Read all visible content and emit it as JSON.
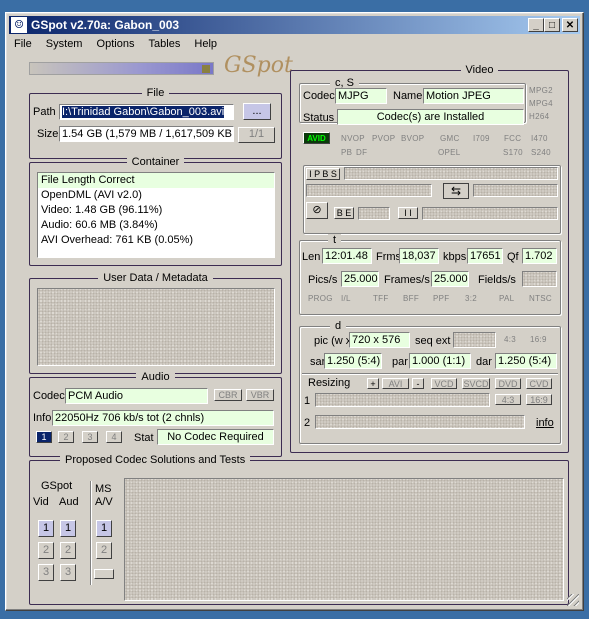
{
  "window": {
    "title": "GSpot v2.70a: Gabon_003",
    "logo": "GSpot"
  },
  "colors": {
    "title_start": "#0a246a",
    "title_end": "#a6caf0",
    "status_green": "#e8ffe0",
    "avid_green": "#00ff00"
  },
  "menu": [
    "File",
    "System",
    "Options",
    "Tables",
    "Help"
  ],
  "file": {
    "title": "File",
    "path_label": "Path",
    "path_value": "I:\\Trinidad Gabon\\Gabon_003.avi",
    "browse_label": "...",
    "size_label": "Size",
    "size_value": "1.54 GB (1,579 MB / 1,617,509 KB",
    "page_indicator": "1/1"
  },
  "container": {
    "title": "Container",
    "lines": [
      "File Length Correct",
      "OpenDML (AVI v2.0)",
      "Video: 1.48 GB (96.11%)",
      "Audio: 60.6 MB (3.84%)",
      "AVI Overhead: 761 KB (0.05%)"
    ]
  },
  "userdata": {
    "title": "User Data / Metadata"
  },
  "audio": {
    "title": "Audio",
    "codec_label": "Codec",
    "codec_value": "PCM Audio",
    "cbr": "CBR",
    "vbr": "VBR",
    "info_label": "Info",
    "info_value": "22050Hz  706 kb/s tot (2 chnls)",
    "streams": [
      "1",
      "2",
      "3",
      "4"
    ],
    "stat_label": "Stat",
    "stat_value": "No Codec Required"
  },
  "codecs": {
    "title": "Proposed Codec Solutions and Tests",
    "gspot_label": "GSpot",
    "vid_label": "Vid",
    "aud_label": "Aud",
    "ms_label": "MS",
    "av_label": "A/V",
    "nums": [
      "1",
      "2",
      "3"
    ]
  },
  "video": {
    "title": "Video",
    "cs_title": "c, S",
    "codec_label": "Codec",
    "codec_value": "MJPG",
    "name_label": "Name",
    "name_value": "Motion JPEG",
    "mpg2": "MPG2",
    "mpg4": "MPG4",
    "h264": "H264",
    "status_label": "Status",
    "status_value": "Codec(s) are Installed",
    "avid": "AVID",
    "nvop": "NVOP",
    "pvop": "PVOP",
    "bvop": "BVOP",
    "gmc": "GMC",
    "opel": "OPEL",
    "i709": "I709",
    "fcc": "FCC",
    "i470": "I470",
    "s170": "S170",
    "s240": "S240",
    "pb": "PB",
    "df": "DF",
    "ipbs": "I P B S",
    "be": "B E",
    "ii": "I I",
    "t_title": "t",
    "len_label": "Len",
    "len_value": "12:01.48",
    "frms_label": "Frms",
    "frms_value": "18,037",
    "kbps_label": "kbps",
    "kbps_value": "17651",
    "qf_label": "Qf",
    "qf_value": "1.702",
    "pics_label": "Pics/s",
    "pics_value": "25.000",
    "frames_label": "Frames/s",
    "frames_value": "25.000",
    "fields_label": "Fields/s",
    "prog": "PROG",
    "il": "I/L",
    "tff": "TFF",
    "bff": "BFF",
    "ppf": "PPF",
    "ratio32": "3:2",
    "pal": "PAL",
    "ntsc": "NTSC",
    "d_title": "d",
    "pic_label": "pic (w x",
    "pic_value": "720 x 576",
    "seqext_label": "seq ext",
    "r43": "4:3",
    "r169": "16:9",
    "sar_label": "sar",
    "sar_value": "1.250 (5:4)",
    "par_label": "par",
    "par_value": "1.000 (1:1)",
    "dar_label": "dar",
    "dar_value": "1.250 (5:4)",
    "resizing_label": "Resizing",
    "plus": "+",
    "avi": "AVI",
    "minus": "-",
    "vcd": "VCD",
    "svcd": "SVCD",
    "dvd": "DVD",
    "cvd": "CVD",
    "row1": "1",
    "row2": "2",
    "b43": "4:3",
    "b169": "16:9",
    "info_link": "info"
  }
}
